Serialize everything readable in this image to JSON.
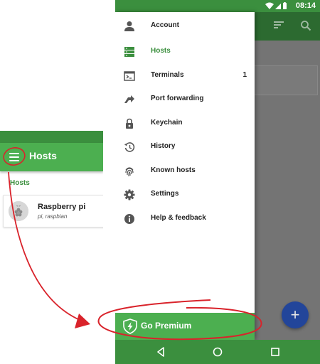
{
  "colors": {
    "status_green": "#3b8f3e",
    "toolbar_green": "#4caf50",
    "annotation_red": "#d9232b",
    "fab_blue": "#22459a"
  },
  "mini": {
    "toolbar_title": "Hosts",
    "section_label": "Hosts",
    "host": {
      "name": "Raspberry pi",
      "subtitle": "pi, raspbian"
    }
  },
  "status_bar": {
    "time": "08:14",
    "icons": [
      "wifi-icon",
      "cellular-icon",
      "battery-icon"
    ]
  },
  "drawer": {
    "items": [
      {
        "icon": "account-icon",
        "label": "Account",
        "count": ""
      },
      {
        "icon": "hosts-icon",
        "label": "Hosts",
        "count": "",
        "active": true
      },
      {
        "icon": "terminal-icon",
        "label": "Terminals",
        "count": "1"
      },
      {
        "icon": "port-forwarding-icon",
        "label": "Port forwarding",
        "count": ""
      },
      {
        "icon": "keychain-icon",
        "label": "Keychain",
        "count": ""
      },
      {
        "icon": "history-icon",
        "label": "History",
        "count": ""
      },
      {
        "icon": "fingerprint-icon",
        "label": "Known hosts",
        "count": ""
      },
      {
        "icon": "settings-icon",
        "label": "Settings",
        "count": ""
      },
      {
        "icon": "help-icon",
        "label": "Help & feedback",
        "count": ""
      }
    ],
    "premium_label": "Go Premium"
  },
  "fab": {
    "label": "+"
  },
  "nav_bar": [
    "back-icon",
    "home-icon",
    "recents-icon"
  ]
}
